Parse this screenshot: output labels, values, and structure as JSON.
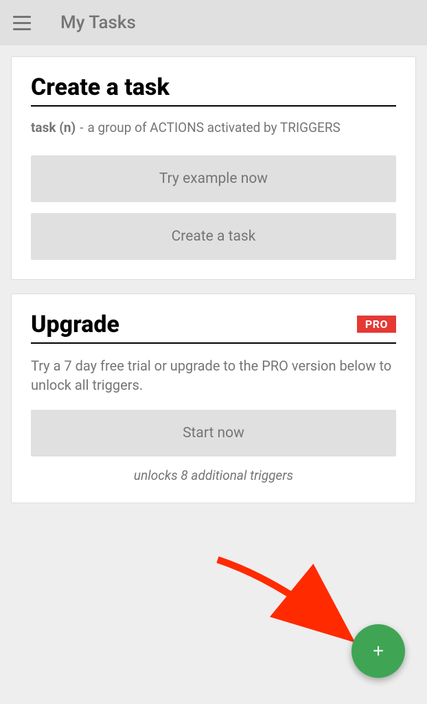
{
  "header": {
    "title": "My Tasks"
  },
  "createCard": {
    "title": "Create a task",
    "term": "task (n)",
    "dash": "-",
    "definition": "a group of ACTIONS activated by TRIGGERS",
    "tryButton": "Try example now",
    "createButton": "Create a task"
  },
  "upgradeCard": {
    "title": "Upgrade",
    "badge": "PRO",
    "description": "Try a 7 day free trial or upgrade to the PRO version below to unlock all triggers.",
    "startButton": "Start now",
    "note": "unlocks 8 additional triggers"
  },
  "fab": {
    "glyph": "+"
  }
}
